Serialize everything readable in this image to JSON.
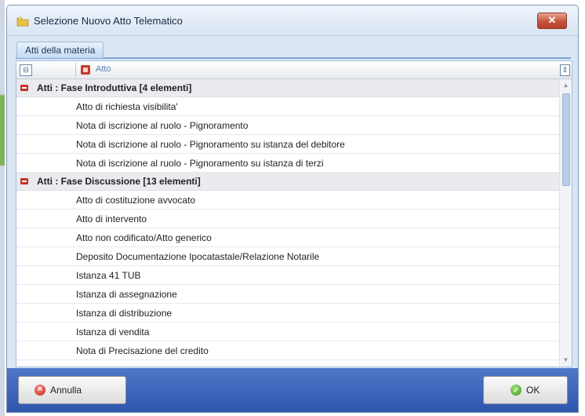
{
  "window": {
    "title": "Selezione Nuovo Atto Telematico",
    "close_label": "✕"
  },
  "tabs": [
    {
      "label": "Atti della materia"
    }
  ],
  "columns": {
    "atto_header": "Atto"
  },
  "groups": [
    {
      "label": "Atti : Fase Introduttiva  [4 elementi]",
      "items": [
        "Atto di richiesta visibilita'",
        "Nota di iscrizione al ruolo - Pignoramento",
        "Nota di iscrizione al ruolo - Pignoramento su istanza del debitore",
        "Nota di iscrizione al ruolo - Pignoramento su istanza di terzi"
      ]
    },
    {
      "label": "Atti : Fase Discussione  [13 elementi]",
      "items": [
        "Atto di costituzione avvocato",
        "Atto di intervento",
        "Atto non codificato/Atto generico",
        "Deposito Documentazione Ipocatastale/Relazione Notarile",
        "Istanza 41 TUB",
        "Istanza di assegnazione",
        "Istanza di distribuzione",
        "Istanza di vendita",
        "Nota di Precisazione del credito"
      ]
    }
  ],
  "footer": {
    "cancel_label": "Annulla",
    "ok_label": "OK"
  },
  "icons": {
    "app": "folder-star-icon",
    "collapse": "collapse-minus-icon",
    "cancel": "cancel-x-icon",
    "ok": "ok-check-icon"
  },
  "colors": {
    "footer_bar": "#3a62b8",
    "group_marker": "#c9302c",
    "close_button": "#c4533b"
  }
}
